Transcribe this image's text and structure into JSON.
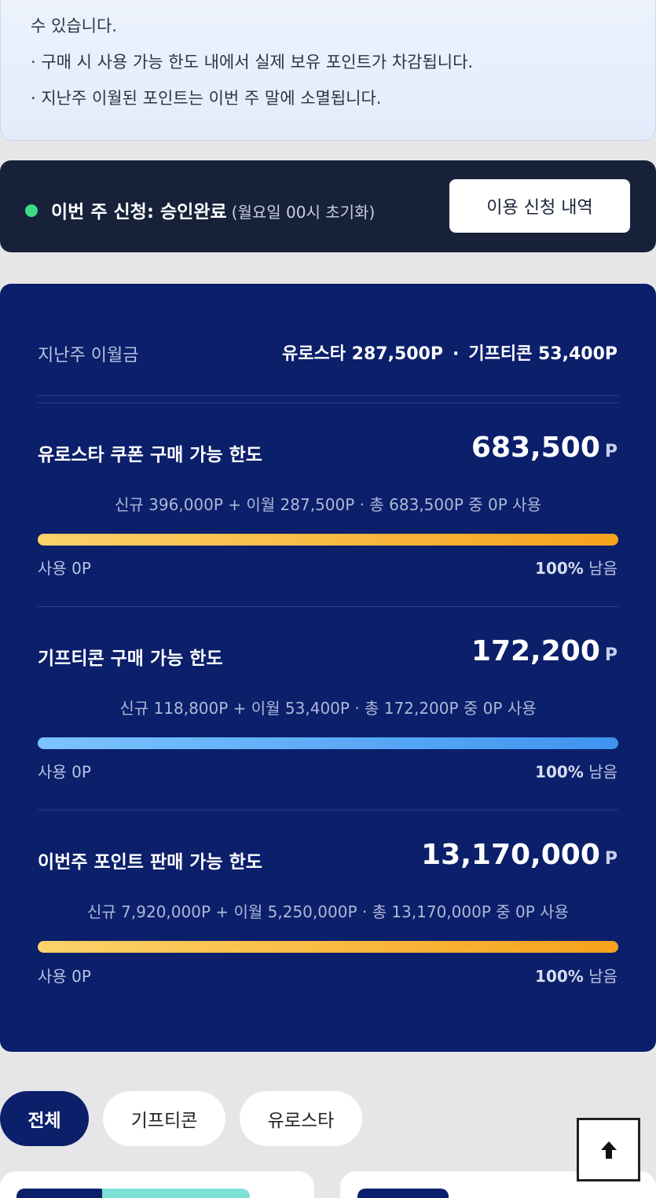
{
  "notice": {
    "lines": [
      "수 있습니다.",
      "· 구매 시 사용 가능 한도 내에서 실제 보유 포인트가 차감됩니다.",
      "· 지난주 이월된 포인트는 이번 주 말에 소멸됩니다."
    ]
  },
  "status": {
    "label": "이번 주 신청: 승인완료",
    "sub": "(월요일 00시 초기화)",
    "dot_color": "#3ddc84",
    "history_button": "이용 신청 내역"
  },
  "carryover": {
    "label": "지난주 이월금",
    "eurostar": "유로스타 287,500P",
    "separator": "·",
    "gifticon": "기프티콘 53,400P"
  },
  "limits": [
    {
      "title": "유로스타 쿠폰 구매 가능 한도",
      "amount": "683,500",
      "unit": "P",
      "detail": "신규 396,000P + 이월 287,500P · 총 683,500P 중 0P 사용",
      "used": "사용 0P",
      "remain_pct": "100%",
      "remain_label": "남음",
      "fill_fraction": 1.0,
      "bar_color": "gold"
    },
    {
      "title": "기프티콘 구매 가능 한도",
      "amount": "172,200",
      "unit": "P",
      "detail": "신규 118,800P + 이월 53,400P · 총 172,200P 중 0P 사용",
      "used": "사용 0P",
      "remain_pct": "100%",
      "remain_label": "남음",
      "fill_fraction": 1.0,
      "bar_color": "blue"
    },
    {
      "title": "이번주 포인트 판매 가능 한도",
      "amount": "13,170,000",
      "unit": "P",
      "detail": "신규 7,920,000P + 이월 5,250,000P · 총 13,170,000P 중 0P 사용",
      "used": "사용 0P",
      "remain_pct": "100%",
      "remain_label": "남음",
      "fill_fraction": 1.0,
      "bar_color": "gold"
    }
  ],
  "filters": {
    "all": "전체",
    "gifticon": "기프티콘",
    "eurostar": "유로스타"
  },
  "icons": {
    "scroll_top": "arrow-up-icon"
  },
  "colors": {
    "panel": "#0b1f6b",
    "status_bar": "#17223a",
    "accent_gold": "#f6a21c",
    "accent_blue": "#3f93ef"
  }
}
